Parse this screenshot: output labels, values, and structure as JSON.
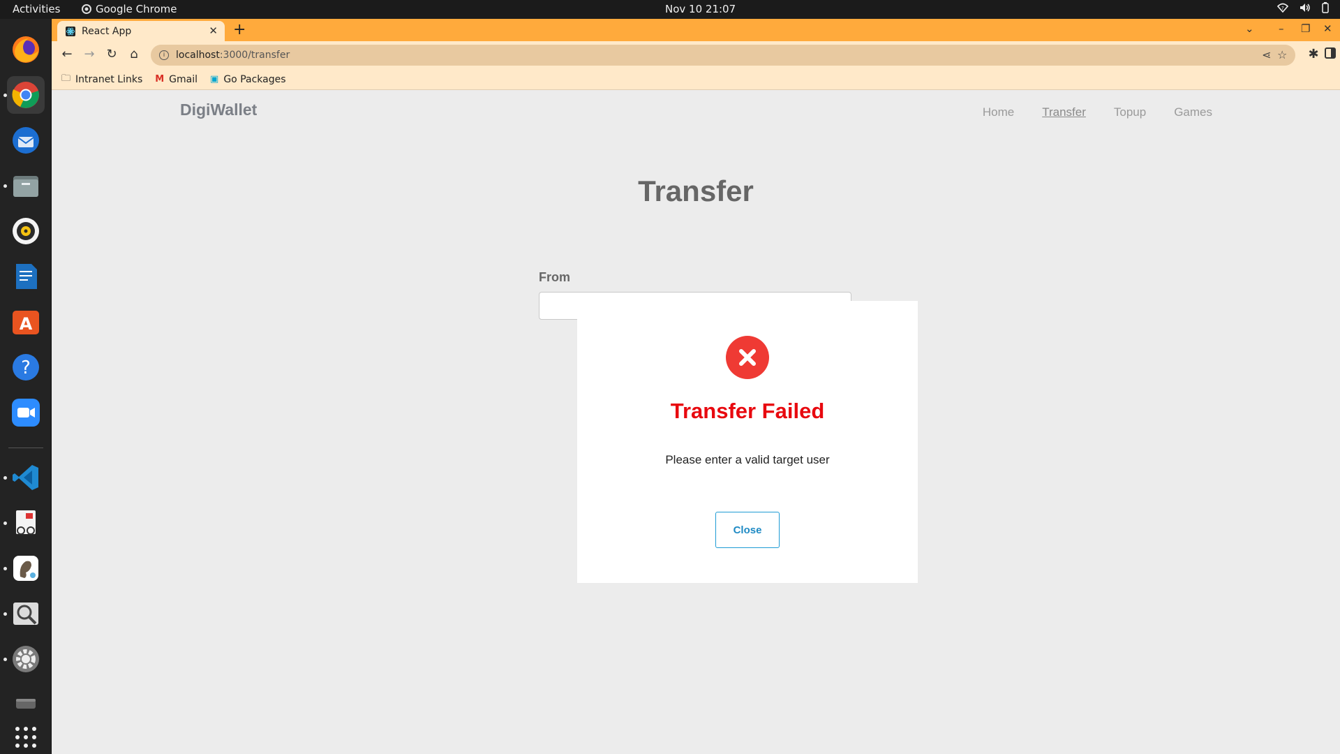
{
  "system": {
    "activities_label": "Activities",
    "focused_app": "Google Chrome",
    "clock": "Nov 10  21:07"
  },
  "dock": {
    "apps": [
      "firefox-icon",
      "chrome-icon",
      "thunderbird-icon",
      "files-icon",
      "rhythmbox-icon",
      "writer-icon",
      "app-center-icon",
      "help-icon",
      "zoom-icon",
      "vscode-icon",
      "document-viewer-icon",
      "gimp-icon",
      "image-viewer-icon",
      "settings-icon",
      "drive-icon",
      "app-grid-icon"
    ]
  },
  "browser": {
    "tab_title": "React App",
    "url_host": "localhost",
    "url_path": ":3000/transfer",
    "bookmarks": [
      "Intranet Links",
      "Gmail",
      "Go Packages"
    ]
  },
  "app": {
    "brand": "DigiWallet",
    "nav": [
      "Home",
      "Transfer",
      "Topup",
      "Games"
    ],
    "active_nav": "Transfer",
    "page_title": "Transfer",
    "from_label": "From"
  },
  "modal": {
    "title": "Transfer Failed",
    "message": "Please enter a valid target user",
    "close_label": "Close"
  },
  "colors": {
    "tab_strip": "#ffaa3c",
    "error_red": "#e8090f",
    "close_blue": "#1e9bd4"
  }
}
